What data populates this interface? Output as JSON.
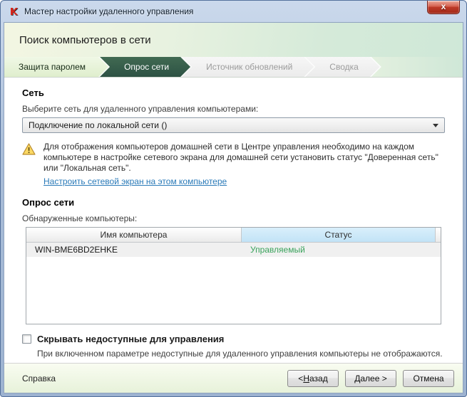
{
  "window": {
    "title": "Мастер настройки удаленного управления",
    "close_glyph": "x"
  },
  "header": {
    "title": "Поиск компьютеров в сети"
  },
  "tabs": [
    {
      "label": "Защита паролем",
      "state": "done"
    },
    {
      "label": "Опрос сети",
      "state": "active"
    },
    {
      "label": "Источник обновлений",
      "state": "upcoming"
    },
    {
      "label": "Сводка",
      "state": "upcoming"
    }
  ],
  "network": {
    "title": "Сеть",
    "select_label": "Выберите сеть для удаленного управления компьютерами:",
    "selected": "Подключение по локальной сети ()"
  },
  "warning": {
    "text": "Для отображения компьютеров домашней сети в Центре управления необходимо на каждом компьютере в настройке сетевого экрана для домашней сети установить статус \"Доверенная сеть\" или \"Локальная сеть\".",
    "link": "Настроить сетевой экран на этом компьютере"
  },
  "poll": {
    "title": "Опрос сети",
    "computers_label": "Обнаруженные компьютеры:",
    "table": {
      "columns": [
        "Имя компьютера",
        "Статус"
      ],
      "rows": [
        {
          "name": "WIN-BME6BD2EHKE",
          "status": "Управляемый"
        }
      ]
    }
  },
  "hide": {
    "label": "Скрывать недоступные для управления",
    "checked": false,
    "description": "При включенном параметре недоступные для удаленного управления компьютеры не отображаются."
  },
  "footer": {
    "help": "Справка",
    "back": {
      "pre": "< ",
      "key": "Н",
      "post": "азад"
    },
    "next": {
      "pre": "",
      "key": "Д",
      "post": "алее >"
    },
    "cancel": "Отмена"
  },
  "colors": {
    "tab_active_green": "#2d5244",
    "status_green": "#3aa35c",
    "link_blue": "#2a7ab8",
    "sorted_col_blue": "#c2e3f6",
    "close_red": "#bd3a28"
  }
}
